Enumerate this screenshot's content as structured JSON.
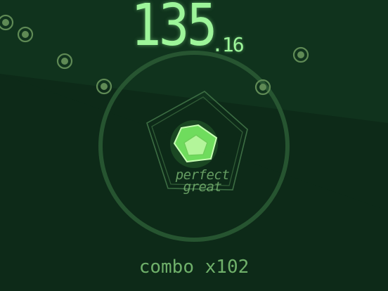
{
  "score": {
    "whole": "135",
    "fraction": ".16"
  },
  "praise": {
    "line1": "perfect",
    "line2": "great"
  },
  "combo": {
    "label": "combo",
    "multiplier": "x102"
  },
  "colors": {
    "background_dark": "#0d2a18",
    "background_light": "#123a22",
    "accent": "#9df59a",
    "ring": "#2c5a36",
    "combo_text": "#6fb06a"
  },
  "icons": {
    "beat_node": "concentric-circle-icon",
    "player": "pentagon-icon"
  }
}
